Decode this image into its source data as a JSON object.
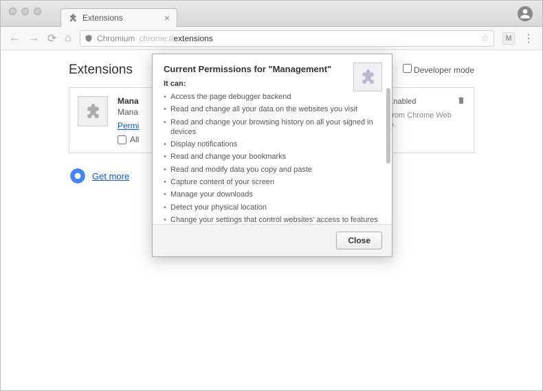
{
  "tab": {
    "title": "Extensions"
  },
  "url": {
    "chromium_label": "Chromium",
    "prefix": "chrome://",
    "path": "extensions"
  },
  "page": {
    "title": "Extensions",
    "dev_mode": "Developer mode",
    "getmore": "Get more"
  },
  "extension": {
    "name": "Mana",
    "description": "Mana",
    "permissions_link": "Permi",
    "allow_incognito": "All",
    "enabled_label": "Enabled",
    "store_note": "Not from Chrome Web Store."
  },
  "modal": {
    "title": "Current Permissions for \"Management\"",
    "subtitle": "It can:",
    "permissions": [
      "Access the page debugger backend",
      "Read and change all your data on the websites you visit",
      "Read and change your browsing history on all your signed in devices",
      "Display notifications",
      "Read and change your bookmarks",
      "Read and modify data you copy and paste",
      "Capture content of your screen",
      "Manage your downloads",
      "Detect your physical location",
      "Change your settings that control websites' access to features such as cookies, JavaScript, plugins, geolocation"
    ],
    "close": "Close"
  },
  "ext_badge": "M"
}
